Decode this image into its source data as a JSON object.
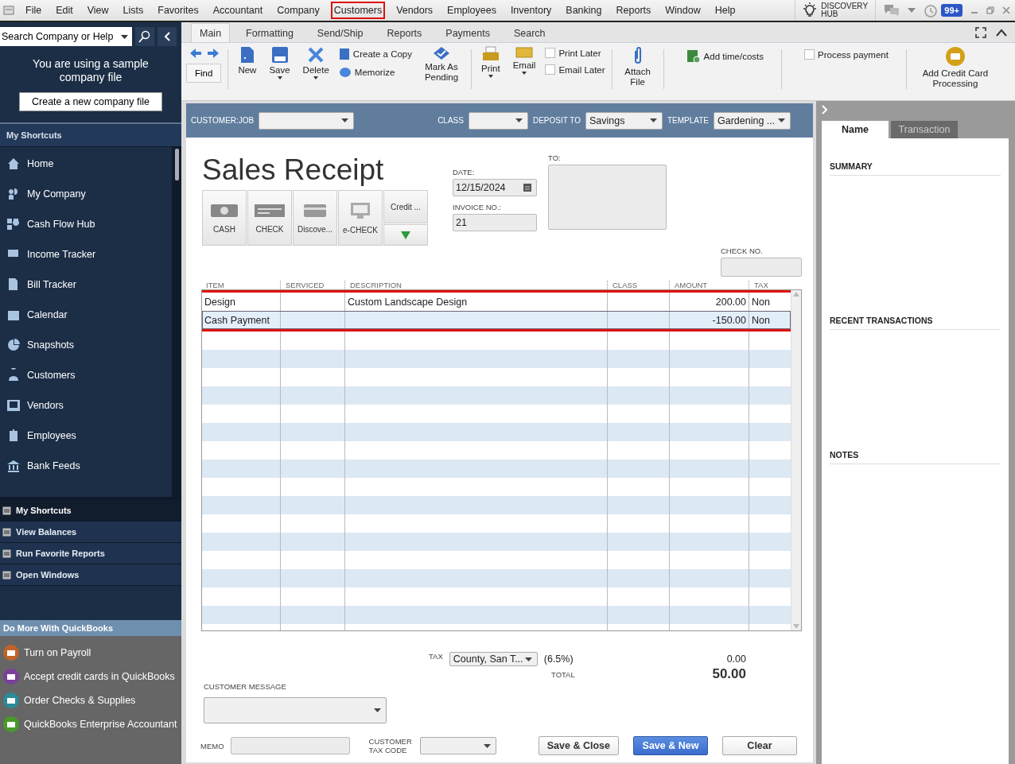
{
  "menu": [
    {
      "label": "File",
      "highlighted": false
    },
    {
      "label": "Edit",
      "highlighted": false
    },
    {
      "label": "View",
      "highlighted": false
    },
    {
      "label": "Lists",
      "highlighted": false
    },
    {
      "label": "Favorites",
      "highlighted": false
    },
    {
      "label": "Accountant",
      "highlighted": false
    },
    {
      "label": "Company",
      "highlighted": false
    },
    {
      "label": "Customers",
      "highlighted": true
    },
    {
      "label": "Vendors",
      "highlighted": false
    },
    {
      "label": "Employees",
      "highlighted": false
    },
    {
      "label": "Inventory",
      "highlighted": false
    },
    {
      "label": "Banking",
      "highlighted": false
    },
    {
      "label": "Reports",
      "highlighted": false
    },
    {
      "label": "Window",
      "highlighted": false
    },
    {
      "label": "Help",
      "highlighted": false
    }
  ],
  "discovery_hub": "DISCOVERY HUB",
  "notification_badge": "99+",
  "sidebar": {
    "search": {
      "placeholder": "Search Company or Help"
    },
    "sample_notice": "You are using a sample company file",
    "create_button": "Create a new company file",
    "shortcuts_header": "My Shortcuts",
    "shortcuts": [
      "Home",
      "My Company",
      "Cash Flow Hub",
      "Income Tracker",
      "Bill Tracker",
      "Calendar",
      "Snapshots",
      "Customers",
      "Vendors",
      "Employees",
      "Bank Feeds"
    ],
    "bottom_tabs": [
      {
        "label": "My Shortcuts",
        "selected": true
      },
      {
        "label": "View Balances",
        "selected": false
      },
      {
        "label": "Run Favorite Reports",
        "selected": false
      },
      {
        "label": "Open Windows",
        "selected": false
      }
    ],
    "more_header": "Do More With QuickBooks",
    "more_items": [
      {
        "label": "Turn on Payroll",
        "color": "#c0632b"
      },
      {
        "label": "Accept credit cards in QuickBooks",
        "color": "#7a3f9c"
      },
      {
        "label": "Order Checks & Supplies",
        "color": "#2d8a9a"
      },
      {
        "label": "QuickBooks Enterprise Accountant",
        "color": "#4a9a2a"
      }
    ]
  },
  "tabs": [
    {
      "label": "Main",
      "selected": true
    },
    {
      "label": "Formatting",
      "selected": false
    },
    {
      "label": "Send/Ship",
      "selected": false
    },
    {
      "label": "Reports",
      "selected": false
    },
    {
      "label": "Payments",
      "selected": false
    },
    {
      "label": "Search",
      "selected": false
    }
  ],
  "ribbon": {
    "find": "Find",
    "new": "New",
    "save": "Save",
    "delete": "Delete",
    "create_copy": "Create a Copy",
    "memorize": "Memorize",
    "mark_pending": "Mark As Pending",
    "print": "Print",
    "email": "Email",
    "print_later": {
      "label": "Print Later",
      "checked": false
    },
    "email_later": {
      "label": "Email Later",
      "checked": false
    },
    "attach_file": "Attach File",
    "add_time_costs": "Add time/costs",
    "process_payment": {
      "label": "Process payment",
      "checked": false
    },
    "add_credit_card": "Add Credit Card Processing"
  },
  "header_bar": {
    "customer_job": {
      "label": "CUSTOMER:JOB"
    },
    "class": {
      "label": "CLASS"
    },
    "deposit_to": {
      "label": "DEPOSIT TO",
      "value": "Savings"
    },
    "template": {
      "label": "TEMPLATE",
      "value": "Gardening ..."
    }
  },
  "form": {
    "title": "Sales Receipt",
    "payment_methods": [
      {
        "label": "CASH",
        "kind": "cash"
      },
      {
        "label": "CHECK",
        "kind": "check"
      },
      {
        "label": "Discove...",
        "kind": "card"
      },
      {
        "label": "e-CHECK",
        "kind": "echeck"
      }
    ],
    "credit": "Credit ...",
    "date_label": "DATE:",
    "date": "12/15/2024",
    "invoice_label": "INVOICE NO.:",
    "invoice": "21",
    "to_label": "TO:",
    "check_no_label": "CHECK NO."
  },
  "table": {
    "columns": [
      "ITEM",
      "SERVICED",
      "DESCRIPTION",
      "CLASS",
      "AMOUNT",
      "TAX"
    ],
    "highlighted": true,
    "rows": [
      {
        "item": "Design",
        "description": "Custom Landscape Design",
        "amount": "200.00",
        "tax": "Non",
        "selected": false
      },
      {
        "item": "Cash Payment",
        "amount": "-150.00",
        "tax": "Non",
        "selected": true
      }
    ]
  },
  "totals": {
    "tax_label": "TAX",
    "tax_item": "County, San T...",
    "tax_rate": "(6.5%)",
    "tax_amount": "0.00",
    "total_label": "TOTAL",
    "total": "50.00"
  },
  "customer_message_label": "CUSTOMER MESSAGE",
  "memo_label": "MEMO",
  "customer_tax_code_label": "CUSTOMER TAX CODE",
  "buttons": [
    {
      "label": "Save & Close",
      "kind": "default"
    },
    {
      "label": "Save & New",
      "kind": "primary"
    },
    {
      "label": "Clear",
      "kind": "default"
    }
  ],
  "right_panel": {
    "tabs": [
      {
        "label": "Name",
        "selected": true
      },
      {
        "label": "Transaction",
        "selected": false
      }
    ],
    "sections": [
      "SUMMARY",
      "RECENT TRANSACTIONS",
      "NOTES"
    ]
  }
}
